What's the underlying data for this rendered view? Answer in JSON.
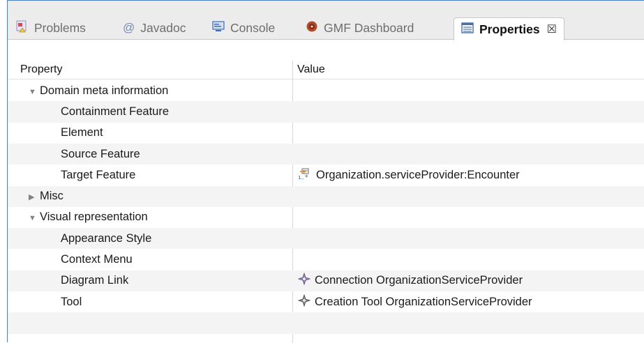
{
  "tabs": [
    {
      "label": "Problems",
      "icon": "problems-icon"
    },
    {
      "label": "Javadoc",
      "icon": "at-sign-icon"
    },
    {
      "label": "Console",
      "icon": "console-icon"
    },
    {
      "label": "GMF Dashboard",
      "icon": "dashboard-icon"
    },
    {
      "label": "Properties",
      "icon": "properties-table-icon",
      "close": "☒"
    }
  ],
  "table": {
    "header_property": "Property",
    "header_value": "Value",
    "rows": [
      {
        "property": "Domain meta information",
        "expanded": true,
        "value": ""
      },
      {
        "property": "Containment Feature",
        "value": ""
      },
      {
        "property": "Element",
        "value": ""
      },
      {
        "property": "Source Feature",
        "value": ""
      },
      {
        "property": "Target Feature",
        "value": "Organization.serviceProvider:Encounter",
        "value_icon": "reference-feature-icon"
      },
      {
        "property": "Misc",
        "expanded": false,
        "value": ""
      },
      {
        "property": "Visual representation",
        "expanded": true,
        "value": ""
      },
      {
        "property": "Appearance Style",
        "value": ""
      },
      {
        "property": "Context Menu",
        "value": ""
      },
      {
        "property": "Diagram Link",
        "value": "Connection OrganizationServiceProvider",
        "value_icon": "connection-diamond-icon"
      },
      {
        "property": "Tool",
        "value": "Creation Tool OrganizationServiceProvider",
        "value_icon": "tool-diamond-icon"
      }
    ]
  }
}
